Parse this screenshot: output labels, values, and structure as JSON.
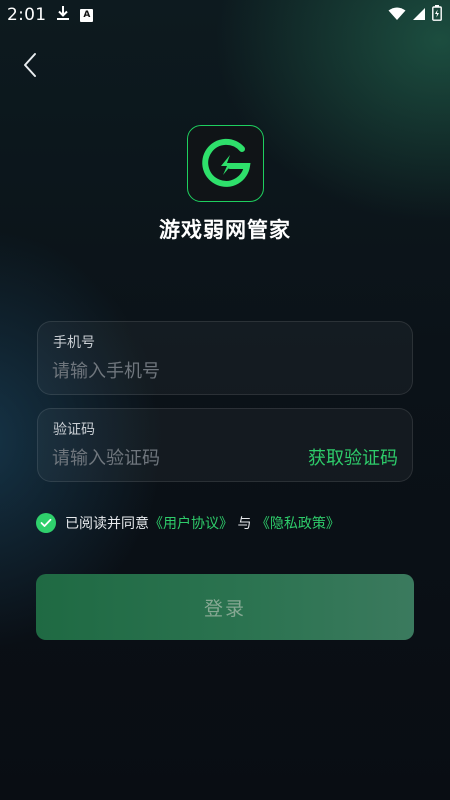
{
  "status_bar": {
    "time": "2:01",
    "icons": [
      "download-icon",
      "a-badge-icon",
      "wifi-icon",
      "signal-icon",
      "battery-icon"
    ],
    "a_badge": "A"
  },
  "app": {
    "name": "游戏弱网管家",
    "logo_letter": "G"
  },
  "phone": {
    "label": "手机号",
    "placeholder": "请输入手机号",
    "value": ""
  },
  "code": {
    "label": "验证码",
    "placeholder": "请输入验证码",
    "value": "",
    "get_code": "获取验证码"
  },
  "agreement": {
    "checked": true,
    "prefix": "已阅读并同意",
    "user_agreement": "《用户协议》",
    "conjunction": "与",
    "privacy_policy": "《隐私政策》"
  },
  "login": {
    "label": "登录"
  },
  "colors": {
    "accent": "#2ecb6a",
    "button": "#2b7350",
    "background": "#0b1218"
  }
}
